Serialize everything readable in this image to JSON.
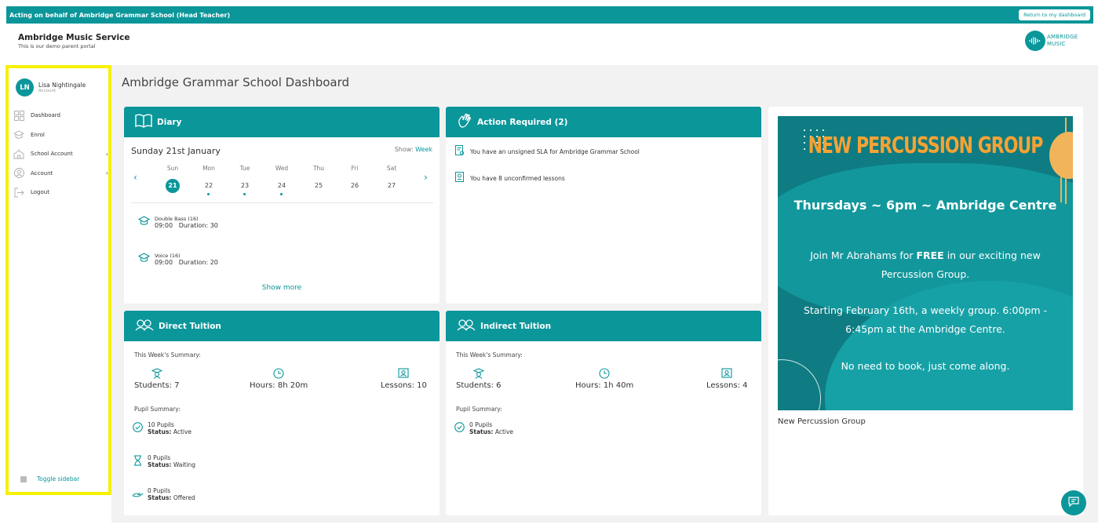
{
  "banner": {
    "text": "Acting on behalf of Ambridge Grammar School (Head Teacher)",
    "return_label": "Return to my dashboard"
  },
  "header": {
    "brand_name": "Ambridge Music Service",
    "brand_sub": "This is our demo parent portal",
    "logo_line1": "AMBRIDGE",
    "logo_line2": "MUSIC"
  },
  "sidebar": {
    "user_initials": "LN",
    "user_name": "Lisa Nightingale",
    "user_sub": "Account",
    "items": [
      {
        "label": "Dashboard",
        "icon": "dashboard-icon"
      },
      {
        "label": "Enrol",
        "icon": "graduation-cap-icon"
      },
      {
        "label": "School Account",
        "icon": "school-icon",
        "chevron": "›"
      },
      {
        "label": "Account",
        "icon": "user-circle-icon",
        "chevron": "›"
      },
      {
        "label": "Logout",
        "icon": "logout-icon"
      }
    ],
    "toggle_label": "Toggle sidebar"
  },
  "page": {
    "title": "Ambridge Grammar School Dashboard"
  },
  "diary": {
    "title": "Diary",
    "date": "Sunday 21st January",
    "show_label": "Show:",
    "show_value": "Week",
    "days": [
      "Sun",
      "Mon",
      "Tue",
      "Wed",
      "Thu",
      "Fri",
      "Sat"
    ],
    "dates": [
      "21",
      "22",
      "23",
      "24",
      "25",
      "26",
      "27"
    ],
    "lessons": [
      {
        "name": "Double Bass (16)",
        "time": "09:00",
        "duration_label": "Duration: 30"
      },
      {
        "name": "Voice (16)",
        "time": "09:00",
        "duration_label": "Duration: 20"
      }
    ],
    "show_more": "Show more"
  },
  "action_required": {
    "title": "Action Required (2)",
    "items": [
      "You have an unsigned SLA for Ambridge Grammar School",
      "You have 8 unconfirmed lessons"
    ]
  },
  "direct_tuition": {
    "title": "Direct Tuition",
    "week_summary_label": "This Week's Summary:",
    "students": "Students: 7",
    "hours": "Hours: 8h 20m",
    "lessons": "Lessons: 10",
    "pupil_summary_label": "Pupil Summary:",
    "pupils": [
      {
        "count": "10 Pupils",
        "status_label": "Status:",
        "status": "Active",
        "icon": "check-circle-icon"
      },
      {
        "count": "0 Pupils",
        "status_label": "Status:",
        "status": "Waiting",
        "icon": "hourglass-icon"
      },
      {
        "count": "0 Pupils",
        "status_label": "Status:",
        "status": "Offered",
        "icon": "hand-offer-icon"
      }
    ]
  },
  "indirect_tuition": {
    "title": "Indirect Tuition",
    "week_summary_label": "This Week's Summary:",
    "students": "Students: 6",
    "hours": "Hours: 1h 40m",
    "lessons": "Lessons: 4",
    "pupil_summary_label": "Pupil Summary:",
    "pupils": [
      {
        "count": "0 Pupils",
        "status_label": "Status:",
        "status": "Active",
        "icon": "check-circle-icon"
      }
    ]
  },
  "promo": {
    "poster_title": "NEW PERCUSSION GROUP",
    "poster_sub": "Thursdays ~ 6pm ~ Ambridge Centre",
    "poster_line1_pre": "Join Mr Abrahams for ",
    "poster_line1_bold": "FREE",
    "poster_line1_post": " in our exciting new Percussion Group.",
    "poster_line2": "Starting February 16th, a weekly group. 6:00pm - 6:45pm at the Ambridge Centre.",
    "poster_line3": "No need to book, just come along.",
    "caption": "New Percussion Group"
  },
  "colors": {
    "accent": "#0b969a",
    "highlight": "#f7f000",
    "poster_title": "#f7a233"
  }
}
